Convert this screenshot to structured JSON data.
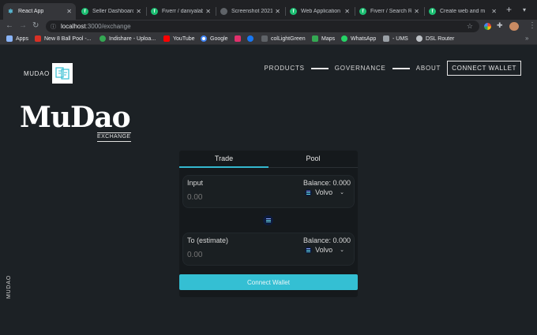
{
  "browser": {
    "tabs": [
      {
        "title": "React App",
        "active": true,
        "favicon_color": "#61dafb",
        "favicon": ""
      },
      {
        "title": "Seller Dashboard",
        "active": false,
        "favicon_color": "#1dbf73",
        "favicon": "fi"
      },
      {
        "title": "Fiverr / daniyalabe",
        "active": false,
        "favicon_color": "#1dbf73",
        "favicon": "fi"
      },
      {
        "title": "Screenshot 2021-",
        "active": false,
        "favicon_color": "#5f6368",
        "favicon": ""
      },
      {
        "title": "Web Application S",
        "active": false,
        "favicon_color": "#1dbf73",
        "favicon": "fi"
      },
      {
        "title": "Fiverr / Search Re",
        "active": false,
        "favicon_color": "#1dbf73",
        "favicon": "fi"
      },
      {
        "title": "Create web and m",
        "active": false,
        "favicon_color": "#1dbf73",
        "favicon": "fi"
      }
    ],
    "url_host": "localhost",
    "url_path": ":3000/exchange",
    "bookmarks": [
      {
        "label": "Apps",
        "icon_color": "#8ab4f8"
      },
      {
        "label": "New 8 Ball Pool -...",
        "icon_color": "#d93025"
      },
      {
        "label": "Indishare - Uploa...",
        "icon_color": "#34a853"
      },
      {
        "label": "YouTube",
        "icon_color": "#ff0000"
      },
      {
        "label": "Google",
        "icon_color": "#4285f4"
      },
      {
        "label": "",
        "icon_color": "#e1306c"
      },
      {
        "label": "",
        "icon_color": "#1877f2"
      },
      {
        "label": "colLightGreen",
        "icon_color": "#5f6368"
      },
      {
        "label": "Maps",
        "icon_color": "#34a853"
      },
      {
        "label": "WhatsApp",
        "icon_color": "#25d366"
      },
      {
        "label": "- UMS",
        "icon_color": "#9aa0a6"
      },
      {
        "label": "DSL Router",
        "icon_color": "#bdc1c6"
      }
    ]
  },
  "header": {
    "brand": "MUDAO",
    "nav": [
      "PRODUCTS",
      "GOVERNANCE",
      "ABOUT"
    ],
    "connect_label": "CONNECT WALLET"
  },
  "hero": {
    "title": "MuDao",
    "subtitle": "EXCHANGE"
  },
  "side_label": "MUDAO",
  "exchange": {
    "tabs": [
      "Trade",
      "Pool"
    ],
    "active_tab": "Trade",
    "input": {
      "label": "Input",
      "balance": "Balance: 0.000",
      "placeholder": "0.00",
      "token": "Volvo"
    },
    "output": {
      "label": "To (estimate)",
      "balance": "Balance: 0.000",
      "placeholder": "0.00",
      "token": "Volvo"
    },
    "connect_label": "Connect Wallet"
  },
  "colors": {
    "accent": "#34bfd3",
    "background": "#1c2125",
    "card": "#15191c"
  }
}
